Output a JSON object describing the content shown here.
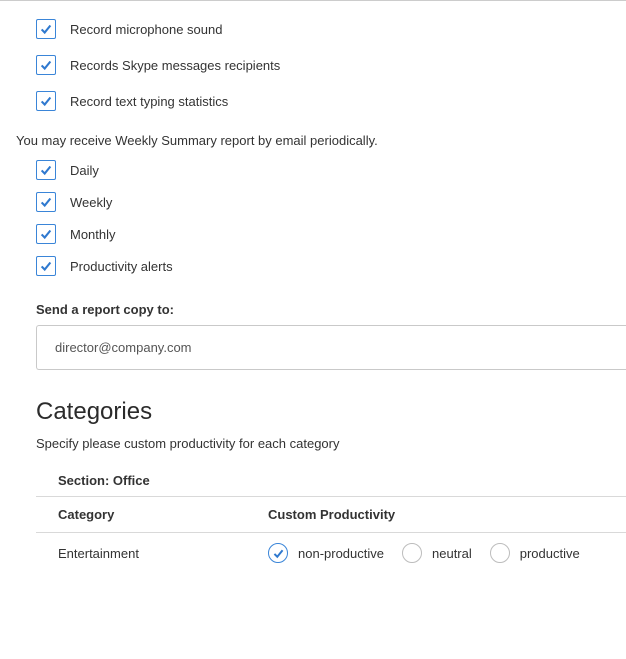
{
  "recording_options": [
    {
      "id": "mic",
      "label": "Record microphone sound",
      "checked": true
    },
    {
      "id": "skype",
      "label": "Records Skype messages recipients",
      "checked": true
    },
    {
      "id": "typing",
      "label": "Record text typing statistics",
      "checked": true
    }
  ],
  "summary_intro": "You may receive Weekly Summary report by email periodically.",
  "schedule_options": [
    {
      "id": "daily",
      "label": "Daily",
      "checked": true
    },
    {
      "id": "weekly",
      "label": "Weekly",
      "checked": true
    },
    {
      "id": "monthly",
      "label": "Monthly",
      "checked": true
    },
    {
      "id": "alerts",
      "label": "Productivity alerts",
      "checked": true
    }
  ],
  "report_copy": {
    "label": "Send a report copy to:",
    "value": "director@company.com"
  },
  "categories": {
    "heading": "Categories",
    "description": "Specify please custom productivity for each category",
    "section_label_prefix": "Section: ",
    "section_name": "Office",
    "columns": {
      "category": "Category",
      "productivity": "Custom Productivity"
    },
    "productivity_values": {
      "nonproductive": "non-productive",
      "neutral": "neutral",
      "productive": "productive"
    },
    "rows": [
      {
        "category": "Entertainment",
        "selected": "nonproductive"
      }
    ]
  }
}
